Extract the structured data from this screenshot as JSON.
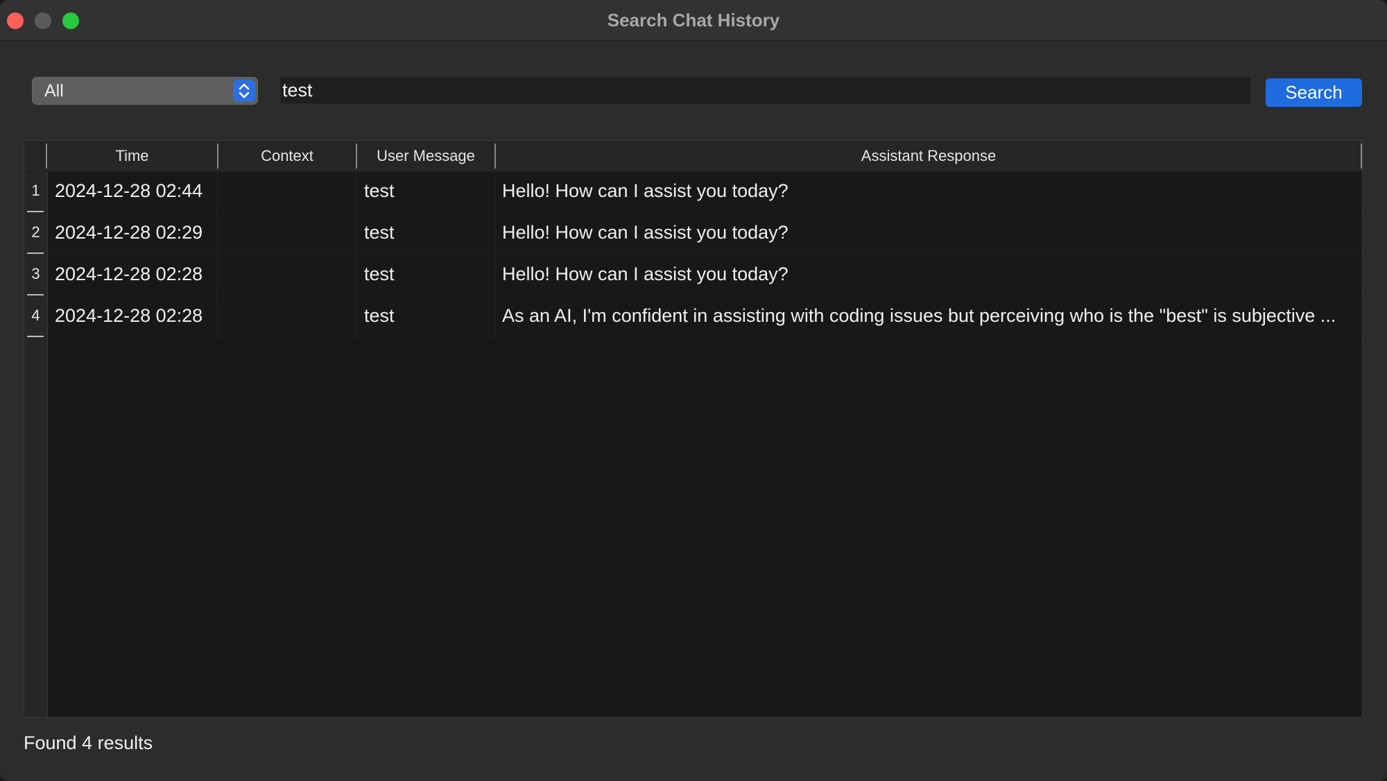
{
  "window": {
    "title": "Search Chat History"
  },
  "search": {
    "scope_selected": "All",
    "query": "test",
    "button_label": "Search"
  },
  "table": {
    "columns": [
      "Time",
      "Context",
      "User Message",
      "Assistant Response"
    ],
    "rows": [
      {
        "num": "1",
        "time": "2024-12-28 02:44",
        "context": "",
        "user": "test",
        "assistant": "Hello! How can I assist you today?"
      },
      {
        "num": "2",
        "time": "2024-12-28 02:29",
        "context": "",
        "user": "test",
        "assistant": "Hello! How can I assist you today?"
      },
      {
        "num": "3",
        "time": "2024-12-28 02:28",
        "context": "",
        "user": "test",
        "assistant": "Hello! How can I assist you today?"
      },
      {
        "num": "4",
        "time": "2024-12-28 02:28",
        "context": "",
        "user": "test",
        "assistant": "As an AI, I'm confident in assisting with coding issues but perceiving who is the \"best\" is subjective ..."
      }
    ]
  },
  "status": {
    "text": "Found 4 results"
  },
  "icons": {
    "close": "close-traffic-light-icon",
    "minimize": "minimize-traffic-light-icon",
    "maximize": "maximize-traffic-light-icon",
    "stepper": "up-down-chevron-icon"
  }
}
